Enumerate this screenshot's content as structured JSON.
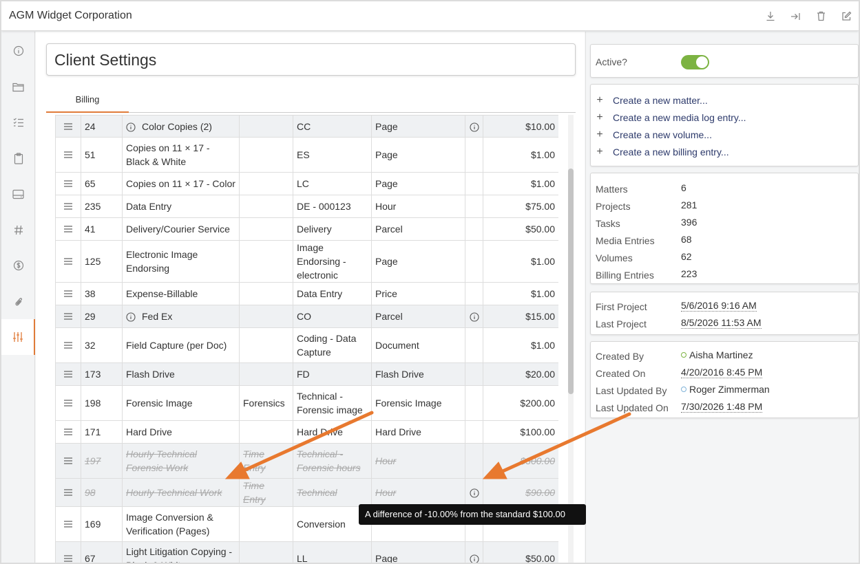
{
  "app": {
    "title": "AGM Widget Corporation"
  },
  "top_actions": [
    {
      "name": "download-icon"
    },
    {
      "name": "export-icon"
    },
    {
      "name": "delete-icon"
    },
    {
      "name": "edit-icon"
    }
  ],
  "sidebar": {
    "items": [
      {
        "name": "info-icon"
      },
      {
        "name": "folder-icon"
      },
      {
        "name": "checklist-icon"
      },
      {
        "name": "clipboard-icon"
      },
      {
        "name": "drive-icon"
      },
      {
        "name": "hash-icon"
      },
      {
        "name": "dollar-icon"
      },
      {
        "name": "paperclip-icon"
      },
      {
        "name": "sliders-icon"
      }
    ]
  },
  "page": {
    "title": "Client Settings"
  },
  "tabs": [
    {
      "label": "Billing"
    }
  ],
  "billing": {
    "rows": [
      {
        "id": "24",
        "desc": "Color Copies (2)",
        "group": "",
        "code": "CC",
        "unit": "Page",
        "rate": "$10.00",
        "has_desc_info": true,
        "has_info": true,
        "shaded": true,
        "deleted": false
      },
      {
        "id": "51",
        "desc": "Copies on 11 × 17 - Black & White",
        "group": "",
        "code": "ES",
        "unit": "Page",
        "rate": "$1.00",
        "has_desc_info": false,
        "has_info": false,
        "shaded": false,
        "deleted": false
      },
      {
        "id": "65",
        "desc": "Copies on 11 × 17 - Color",
        "group": "",
        "code": "LC",
        "unit": "Page",
        "rate": "$1.00",
        "has_desc_info": false,
        "has_info": false,
        "shaded": false,
        "deleted": false
      },
      {
        "id": "235",
        "desc": "Data Entry",
        "group": "",
        "code": "DE - 000123",
        "unit": "Hour",
        "rate": "$75.00",
        "has_desc_info": false,
        "has_info": false,
        "shaded": false,
        "deleted": false
      },
      {
        "id": "41",
        "desc": "Delivery/Courier Service",
        "group": "",
        "code": "Delivery",
        "unit": "Parcel",
        "rate": "$50.00",
        "has_desc_info": false,
        "has_info": false,
        "shaded": false,
        "deleted": false
      },
      {
        "id": "125",
        "desc": "Electronic Image Endorsing",
        "group": "",
        "code": "Image Endorsing - electronic",
        "unit": "Page",
        "rate": "$1.00",
        "has_desc_info": false,
        "has_info": false,
        "shaded": false,
        "deleted": false
      },
      {
        "id": "38",
        "desc": "Expense-Billable",
        "group": "",
        "code": "Data Entry",
        "unit": "Price",
        "rate": "$1.00",
        "has_desc_info": false,
        "has_info": false,
        "shaded": false,
        "deleted": false
      },
      {
        "id": "29",
        "desc": "Fed Ex",
        "group": "",
        "code": "CO",
        "unit": "Parcel",
        "rate": "$15.00",
        "has_desc_info": true,
        "has_info": true,
        "shaded": true,
        "deleted": false
      },
      {
        "id": "32",
        "desc": "Field Capture (per Doc)",
        "group": "",
        "code": "Coding - Data Capture",
        "unit": "Document",
        "rate": "$1.00",
        "has_desc_info": false,
        "has_info": false,
        "shaded": false,
        "deleted": false
      },
      {
        "id": "173",
        "desc": "Flash Drive",
        "group": "",
        "code": "FD",
        "unit": "Flash Drive",
        "rate": "$20.00",
        "has_desc_info": false,
        "has_info": false,
        "shaded": true,
        "deleted": false
      },
      {
        "id": "198",
        "desc": "Forensic Image",
        "group": "Forensics",
        "code": "Technical - Forensic image",
        "unit": "Forensic Image",
        "rate": "$200.00",
        "has_desc_info": false,
        "has_info": false,
        "shaded": false,
        "deleted": false
      },
      {
        "id": "171",
        "desc": "Hard Drive",
        "group": "",
        "code": "Hard Drive",
        "unit": "Hard Drive",
        "rate": "$100.00",
        "has_desc_info": false,
        "has_info": false,
        "shaded": false,
        "deleted": false
      },
      {
        "id": "197",
        "desc": "Hourly Technical Forensic Work",
        "group": "Time Entry",
        "code": "Technical - Forensic hours",
        "unit": "Hour",
        "rate": "$300.00",
        "has_desc_info": false,
        "has_info": false,
        "shaded": true,
        "deleted": true
      },
      {
        "id": "98",
        "desc": "Hourly Technical Work",
        "group": "Time Entry",
        "code": "Technical",
        "unit": "Hour",
        "rate": "$90.00",
        "has_desc_info": false,
        "has_info": true,
        "shaded": true,
        "deleted": true
      },
      {
        "id": "169",
        "desc": "Image Conversion & Verification (Pages)",
        "group": "",
        "code": "Conversion",
        "unit": "",
        "rate": "",
        "has_desc_info": false,
        "has_info": false,
        "shaded": false,
        "deleted": false
      },
      {
        "id": "67",
        "desc": "Light Litigation Copying - Black & White",
        "group": "",
        "code": "LL",
        "unit": "Page",
        "rate": "$50.00",
        "has_desc_info": false,
        "has_info": true,
        "shaded": true,
        "deleted": false
      }
    ]
  },
  "tooltip": {
    "text": "A difference of -10.00% from the standard $100.00"
  },
  "side_panel": {
    "active_label": "Active?",
    "active": true,
    "create_links": [
      "Create a new matter...",
      "Create a new media log entry...",
      "Create a new volume...",
      "Create a new billing entry..."
    ],
    "stats": [
      {
        "label": "Matters",
        "value": "6"
      },
      {
        "label": "Projects",
        "value": "281"
      },
      {
        "label": "Tasks",
        "value": "396"
      },
      {
        "label": "Media Entries",
        "value": "68"
      },
      {
        "label": "Volumes",
        "value": "62"
      },
      {
        "label": "Billing Entries",
        "value": "223"
      }
    ],
    "projects": [
      {
        "label": "First Project",
        "value": "5/6/2016 9:16 AM"
      },
      {
        "label": "Last Project",
        "value": "8/5/2026 11:53 AM"
      }
    ],
    "audit": [
      {
        "label": "Created By",
        "value": "Aisha Martinez",
        "dot": "green"
      },
      {
        "label": "Created On",
        "value": "4/20/2016 8:45 PM"
      },
      {
        "label": "Last Updated By",
        "value": "Roger Zimmerman",
        "dot": "blue"
      },
      {
        "label": "Last Updated On",
        "value": "7/30/2026 1:48 PM"
      }
    ]
  },
  "colors": {
    "accent": "#e07b39",
    "toggle_on": "#7cb342",
    "link": "#2d3a6b"
  }
}
